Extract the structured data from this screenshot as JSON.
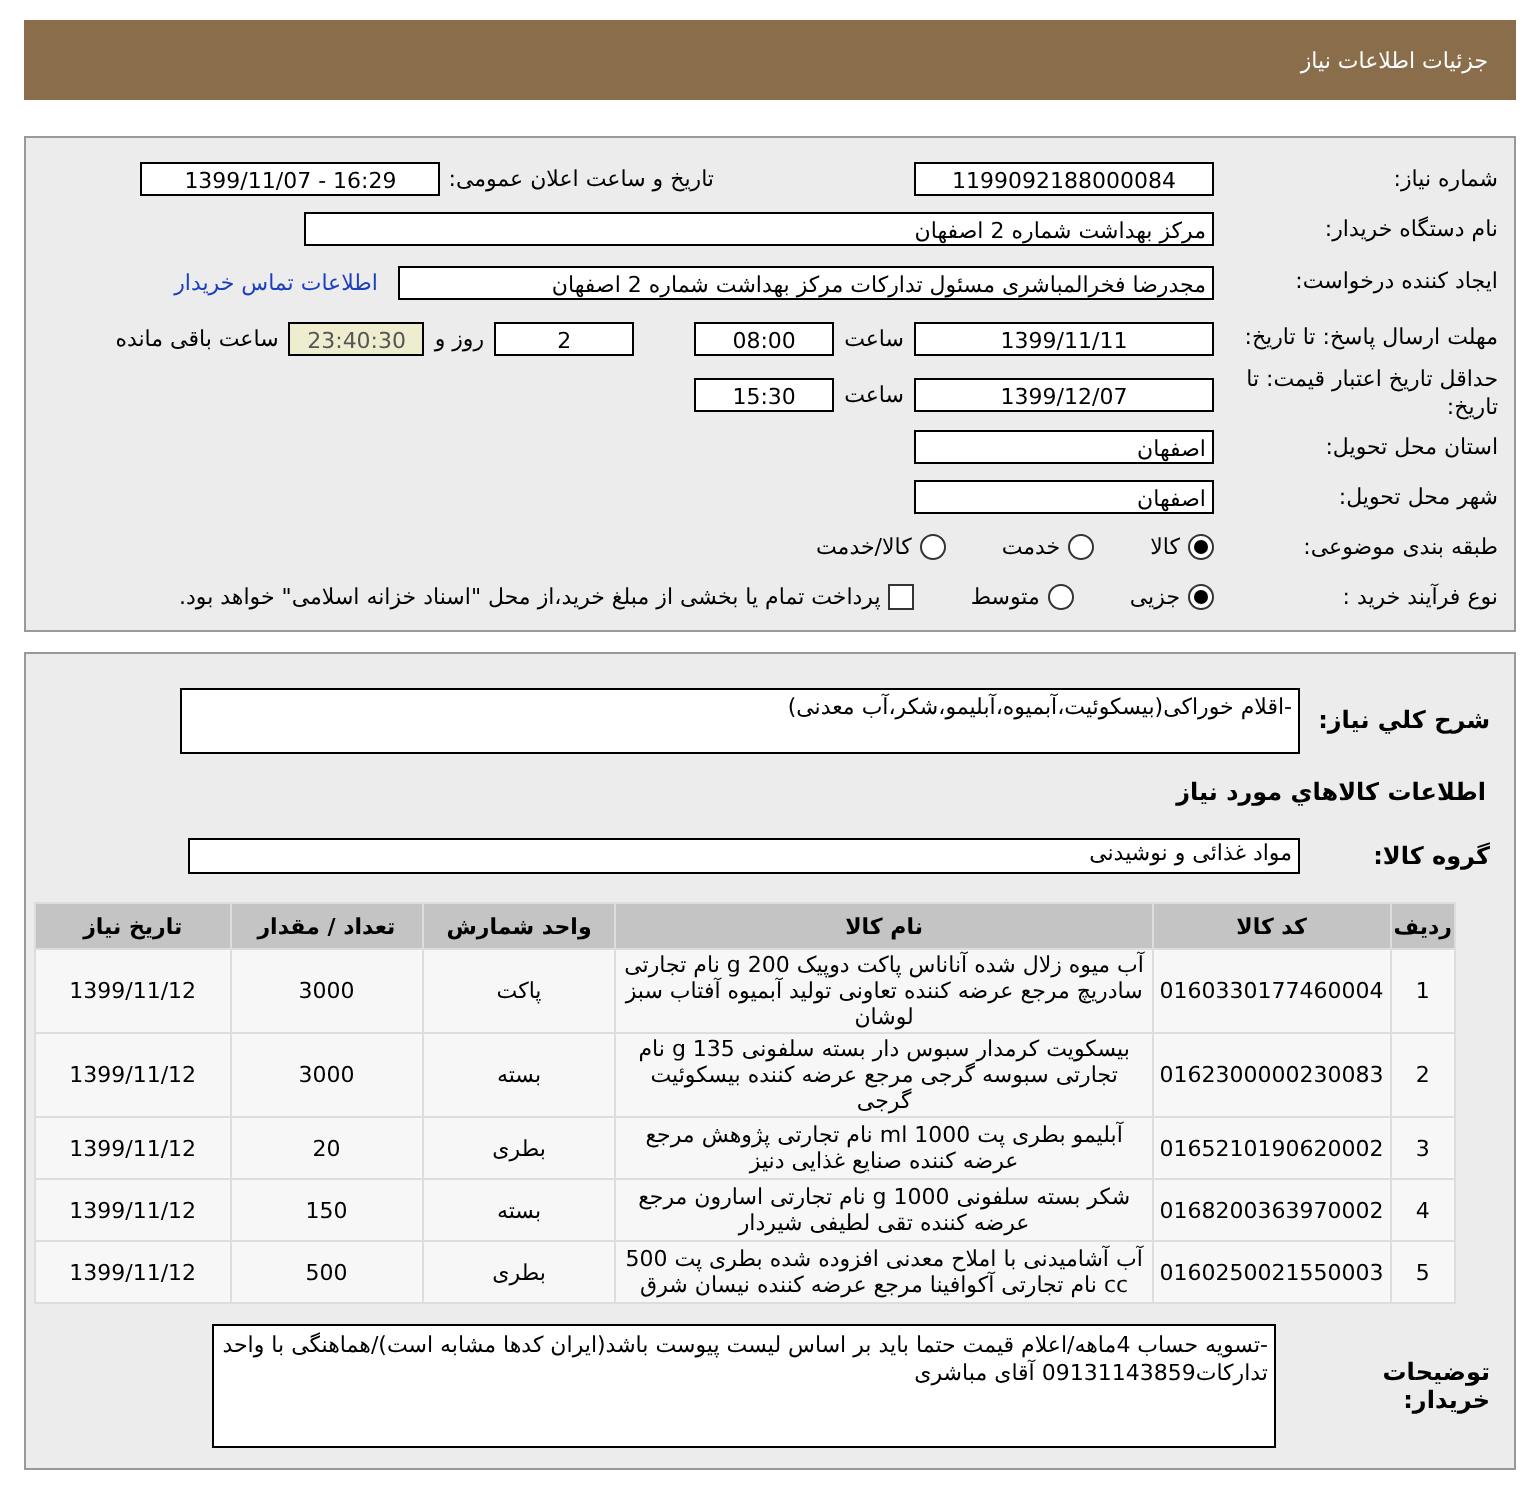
{
  "header": {
    "title": "جزئیات اطلاعات نیاز"
  },
  "need_number": {
    "label": "شماره نیاز:",
    "value": "1199092188000084"
  },
  "announce": {
    "label": "تاریخ و ساعت اعلان عمومی:",
    "value": "1399/11/07 - 16:29"
  },
  "buyer_org": {
    "label": "نام دستگاه خریدار:",
    "value": "مرکز بهداشت شماره 2 اصفهان"
  },
  "requester": {
    "label": "ایجاد کننده درخواست:",
    "value": "مجدرضا فخرالمباشری مسئول تداركات مرکز بهداشت شماره 2 اصفهان",
    "link": "اطلاعات تماس خریدار"
  },
  "reply_deadline": {
    "label": "مهلت ارسال پاسخ: تا تاریخ:",
    "date": "1399/11/11",
    "time_label": "ساعت",
    "time": "08:00",
    "days": "2",
    "days_label": "روز و",
    "remaining": "23:40:30",
    "remaining_label": "ساعت باقی مانده"
  },
  "price_validity": {
    "label": "حداقل تاریخ اعتبار قیمت: تا تاریخ:",
    "date": "1399/12/07",
    "time_label": "ساعت",
    "time": "15:30"
  },
  "province": {
    "label": "استان محل تحویل:",
    "value": "اصفهان"
  },
  "city": {
    "label": "شهر محل تحویل:",
    "value": "اصفهان"
  },
  "category": {
    "label": "طبقه بندی موضوعی:",
    "options": [
      {
        "label": "کالا",
        "selected": true
      },
      {
        "label": "خدمت",
        "selected": false
      },
      {
        "label": "کالا/خدمت",
        "selected": false
      }
    ]
  },
  "purchase_process": {
    "label": "نوع فرآیند خرید :",
    "options": [
      {
        "label": "جزیی",
        "selected": true
      },
      {
        "label": "متوسط",
        "selected": false
      }
    ],
    "checkbox": {
      "label": "پرداخت تمام یا بخشی از مبلغ خرید،از محل \"اسناد خزانه اسلامی\" خواهد بود.",
      "checked": false
    }
  },
  "description": {
    "label": "شرح کلي نياز:",
    "value": "-اقلام خوراکی(بیسکوئیت،آبمیوه،آبلیمو،شکر،آب معدنی)"
  },
  "goods_title": "اطلاعات کالاهاي مورد نياز",
  "goods_group": {
    "label": "گروه کالا:",
    "value": "مواد غذائی و نوشیدنی"
  },
  "table": {
    "columns": [
      "ردیف",
      "کد کالا",
      "نام کالا",
      "واحد شمارش",
      "تعداد / مقدار",
      "تاریخ نیاز"
    ],
    "rows": [
      [
        "1",
        "0160330177460004",
        "آب میوه زلال شده آناناس پاکت دوپیک 200 g نام تجارتی سادریچ مرجع عرضه کننده تعاونی تولید آبمیوه آفتاب سبز لوشان",
        "پاکت",
        "3000",
        "1399/11/12"
      ],
      [
        "2",
        "0162300000230083",
        "بیسکویت کرمدار سبوس دار بسته سلفونی 135 g نام تجارتی سبوسه گرجی مرجع عرضه کننده بیسکوئیت گرجی",
        "بسته",
        "3000",
        "1399/11/12"
      ],
      [
        "3",
        "0165210190620002",
        "آبلیمو بطری پت 1000 ml نام تجارتی پژوهش مرجع عرضه کننده صنایع غذایی دنیز",
        "بطری",
        "20",
        "1399/11/12"
      ],
      [
        "4",
        "0168200363970002",
        "شکر بسته سلفونی 1000 g نام تجارتی اسارون مرجع عرضه کننده تقی لطیفی شیردار",
        "بسته",
        "150",
        "1399/11/12"
      ],
      [
        "5",
        "0160250021550003",
        "آب آشامیدنی با املاح معدنی افزوده شده بطری پت 500 cc نام تجارتی آکوافینا مرجع عرضه کننده نیسان شرق",
        "بطری",
        "500",
        "1399/11/12"
      ]
    ]
  },
  "buyer_notes": {
    "label": "توضیحات خریدار:",
    "value": "-تسویه حساب 4ماهه/اعلام قیمت حتما باید بر اساس لیست پیوست باشد(ایران کدها مشابه است)/هماهنگی با واحد تداركات09131143859 آقای مباشری"
  }
}
